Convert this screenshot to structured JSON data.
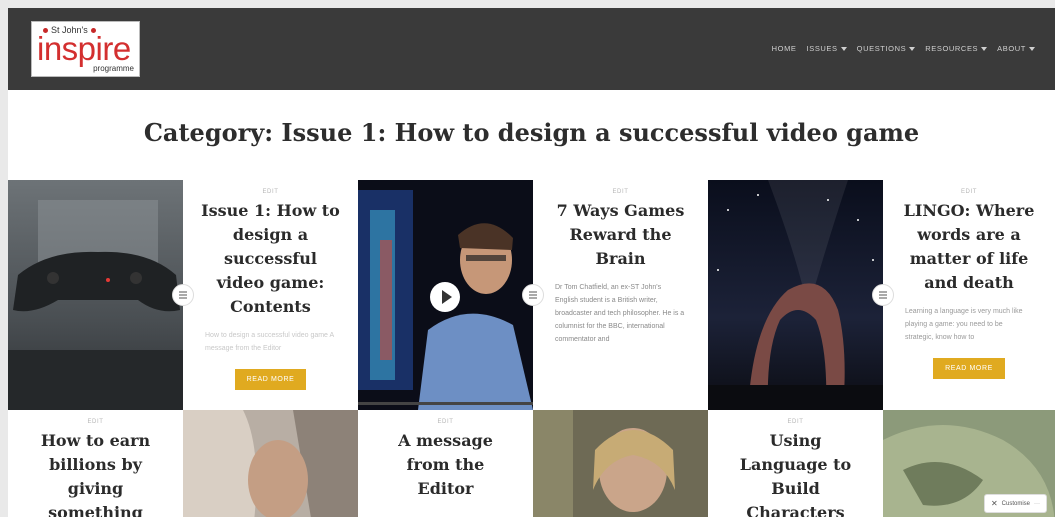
{
  "header": {
    "logo": {
      "top_text": "St John's",
      "main_text": "inspire",
      "sub_text": "programme"
    },
    "nav": [
      {
        "label": "HOME",
        "dropdown": false
      },
      {
        "label": "ISSUES",
        "dropdown": true
      },
      {
        "label": "QUESTIONS",
        "dropdown": true
      },
      {
        "label": "RESOURCES",
        "dropdown": true
      },
      {
        "label": "ABOUT",
        "dropdown": true
      }
    ]
  },
  "page_title": "Category: Issue 1: How to design a successful video game",
  "posts": [
    {
      "edit": "EDIT",
      "title": "Issue 1: How to design a successful video game: Contents",
      "excerpt": "How to design a successful video game A message from the Editor",
      "read_more": "READ MORE"
    },
    {
      "edit": "EDIT",
      "title": "7 Ways Games Reward the Brain",
      "excerpt": "Dr Tom Chatfield, an ex-ST John's English student is a British writer, broadcaster and tech philosopher. He is a columnist for the BBC, international commentator and",
      "read_more": ""
    },
    {
      "edit": "EDIT",
      "title": "LINGO: Where words are a matter of life and death",
      "excerpt": "Learning a language is very much like playing a game: you need to be strategic, know how to",
      "read_more": "READ MORE"
    },
    {
      "edit": "EDIT",
      "title": "How to earn billions by giving something",
      "excerpt": "",
      "read_more": ""
    },
    {
      "edit": "EDIT",
      "title": "A message from the Editor",
      "excerpt": "",
      "read_more": ""
    },
    {
      "edit": "EDIT",
      "title": "Using Language to Build Characters",
      "excerpt": "",
      "read_more": ""
    }
  ],
  "customise_label": "Customise",
  "colors": {
    "header_bg": "#3a3a3a",
    "accent": "#e0aa20",
    "logo_red": "#d32f2f"
  }
}
